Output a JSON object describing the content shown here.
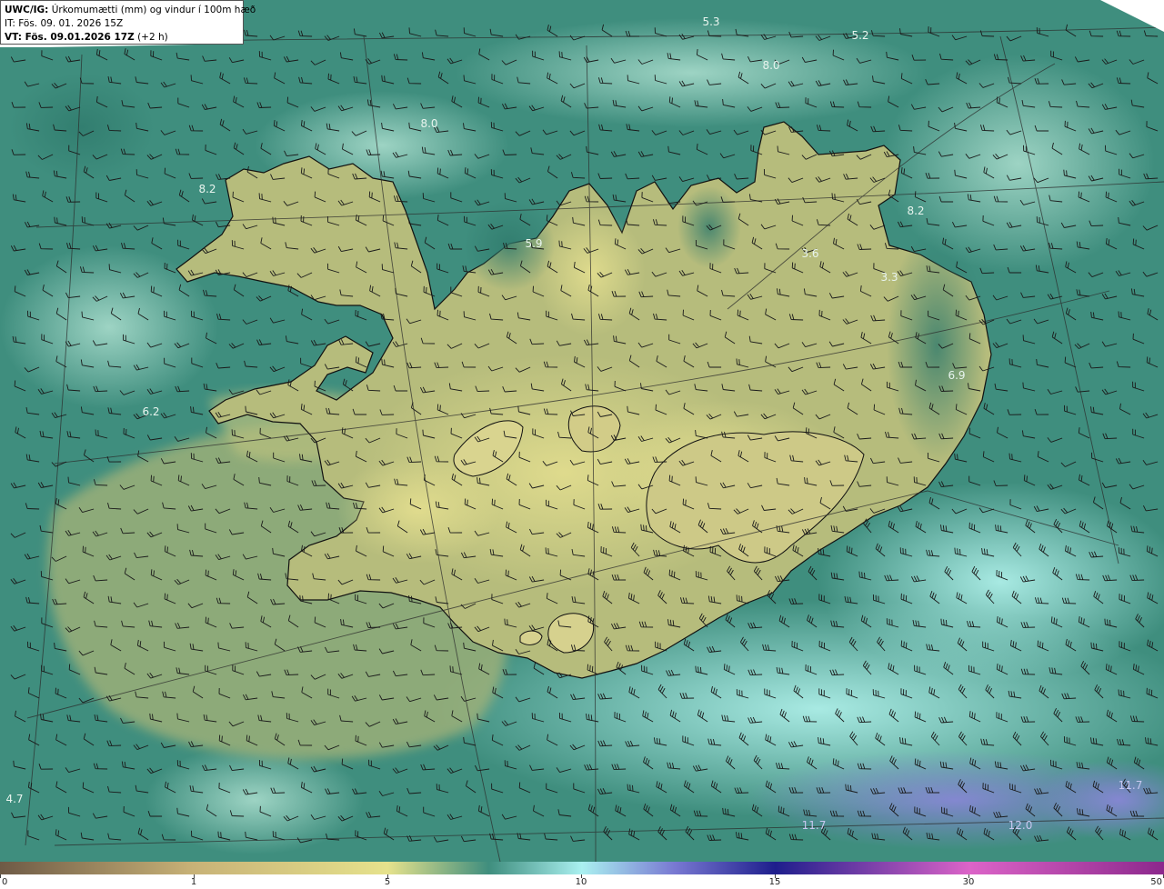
{
  "info": {
    "line1_bold": "UWC/IG:",
    "line1_rest": " Úrkomumætti (mm) og vindur í 100m hæð",
    "line2": "IT: Fös. 09. 01. 2026 15Z",
    "line3_bold": "VT: Fös. 09.01.2026 17Z",
    "line3_rest": " (+2 h)"
  },
  "colorbar": {
    "ticks": [
      "0",
      "1",
      "5",
      "10",
      "15",
      "30",
      "50"
    ],
    "colors": [
      "#6e5a46",
      "#c8b277",
      "#e6e28c",
      "#8cc8a0",
      "#aaf0f0",
      "#7878d2",
      "#1e1e8c",
      "#dc64c8",
      "#8c288c"
    ]
  },
  "map_labels": [
    "5.3",
    "5.2",
    "8.0",
    "8.0",
    "8.2",
    "5.9",
    "3.6",
    "8.2",
    "3.3",
    "6.9",
    "6.2",
    "4.7",
    "11.7",
    "11.7",
    "12.0"
  ],
  "colors": {
    "ocean": "#3f8e7e",
    "ocean_light": "#7ac6b6",
    "land_low": "#9aa56a",
    "land_mid": "#c9cd84",
    "coast": "#111111",
    "wind": "#1a1a1a",
    "label": "#e8f4ee"
  }
}
